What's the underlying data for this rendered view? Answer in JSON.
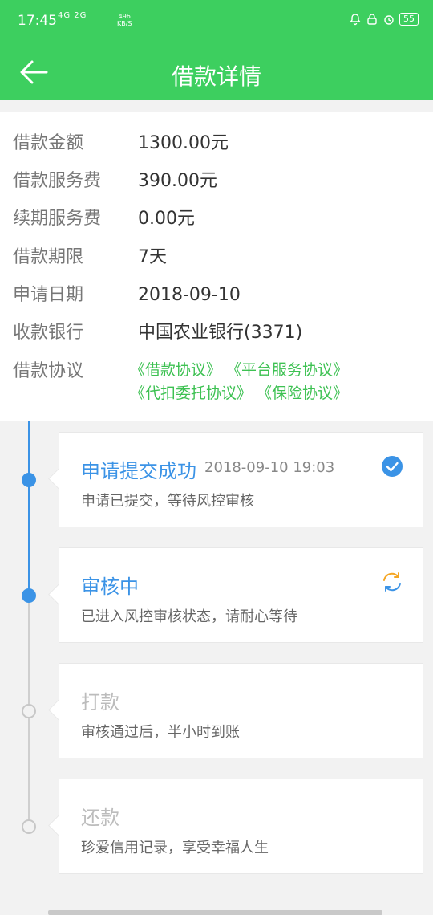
{
  "status_bar": {
    "time": "17:45",
    "network": "4G 2G",
    "speed_value": "496",
    "speed_unit": "KB/S",
    "battery": "55"
  },
  "header": {
    "title": "借款详情",
    "back_icon": "arrow-left-icon"
  },
  "loan_info": {
    "rows": [
      {
        "label": "借款金额",
        "value": "1300.00元"
      },
      {
        "label": "借款服务费",
        "value": "390.00元"
      },
      {
        "label": "续期服务费",
        "value": "0.00元"
      },
      {
        "label": "借款期限",
        "value": "7天"
      },
      {
        "label": "申请日期",
        "value": "2018-09-10"
      },
      {
        "label": "收款银行",
        "value": "中国农业银行(3371)"
      }
    ],
    "agreement_label": "借款协议",
    "agreements": [
      "《借款协议》",
      "《平台服务协议》",
      "《代扣委托协议》",
      "《保险协议》"
    ],
    "link_color": "#3dc152"
  },
  "progress": {
    "active_color": "#3b93e6",
    "steps": [
      {
        "title": "申请提交成功",
        "time": "2018-09-10 19:03",
        "desc": "申请已提交，等待风控审核",
        "status": "done",
        "icon": "check-circle-icon"
      },
      {
        "title": "审核中",
        "time": "",
        "desc": "已进入风控审核状态，请耐心等待",
        "status": "in-progress",
        "icon": "refresh-icon"
      },
      {
        "title": "打款",
        "time": "",
        "desc": "审核通过后，半小时到账",
        "status": "pending",
        "icon": ""
      },
      {
        "title": "还款",
        "time": "",
        "desc": "珍爱信用记录，享受幸福人生",
        "status": "pending",
        "icon": ""
      }
    ]
  },
  "theme": {
    "brand_green": "#3dcf5f"
  }
}
